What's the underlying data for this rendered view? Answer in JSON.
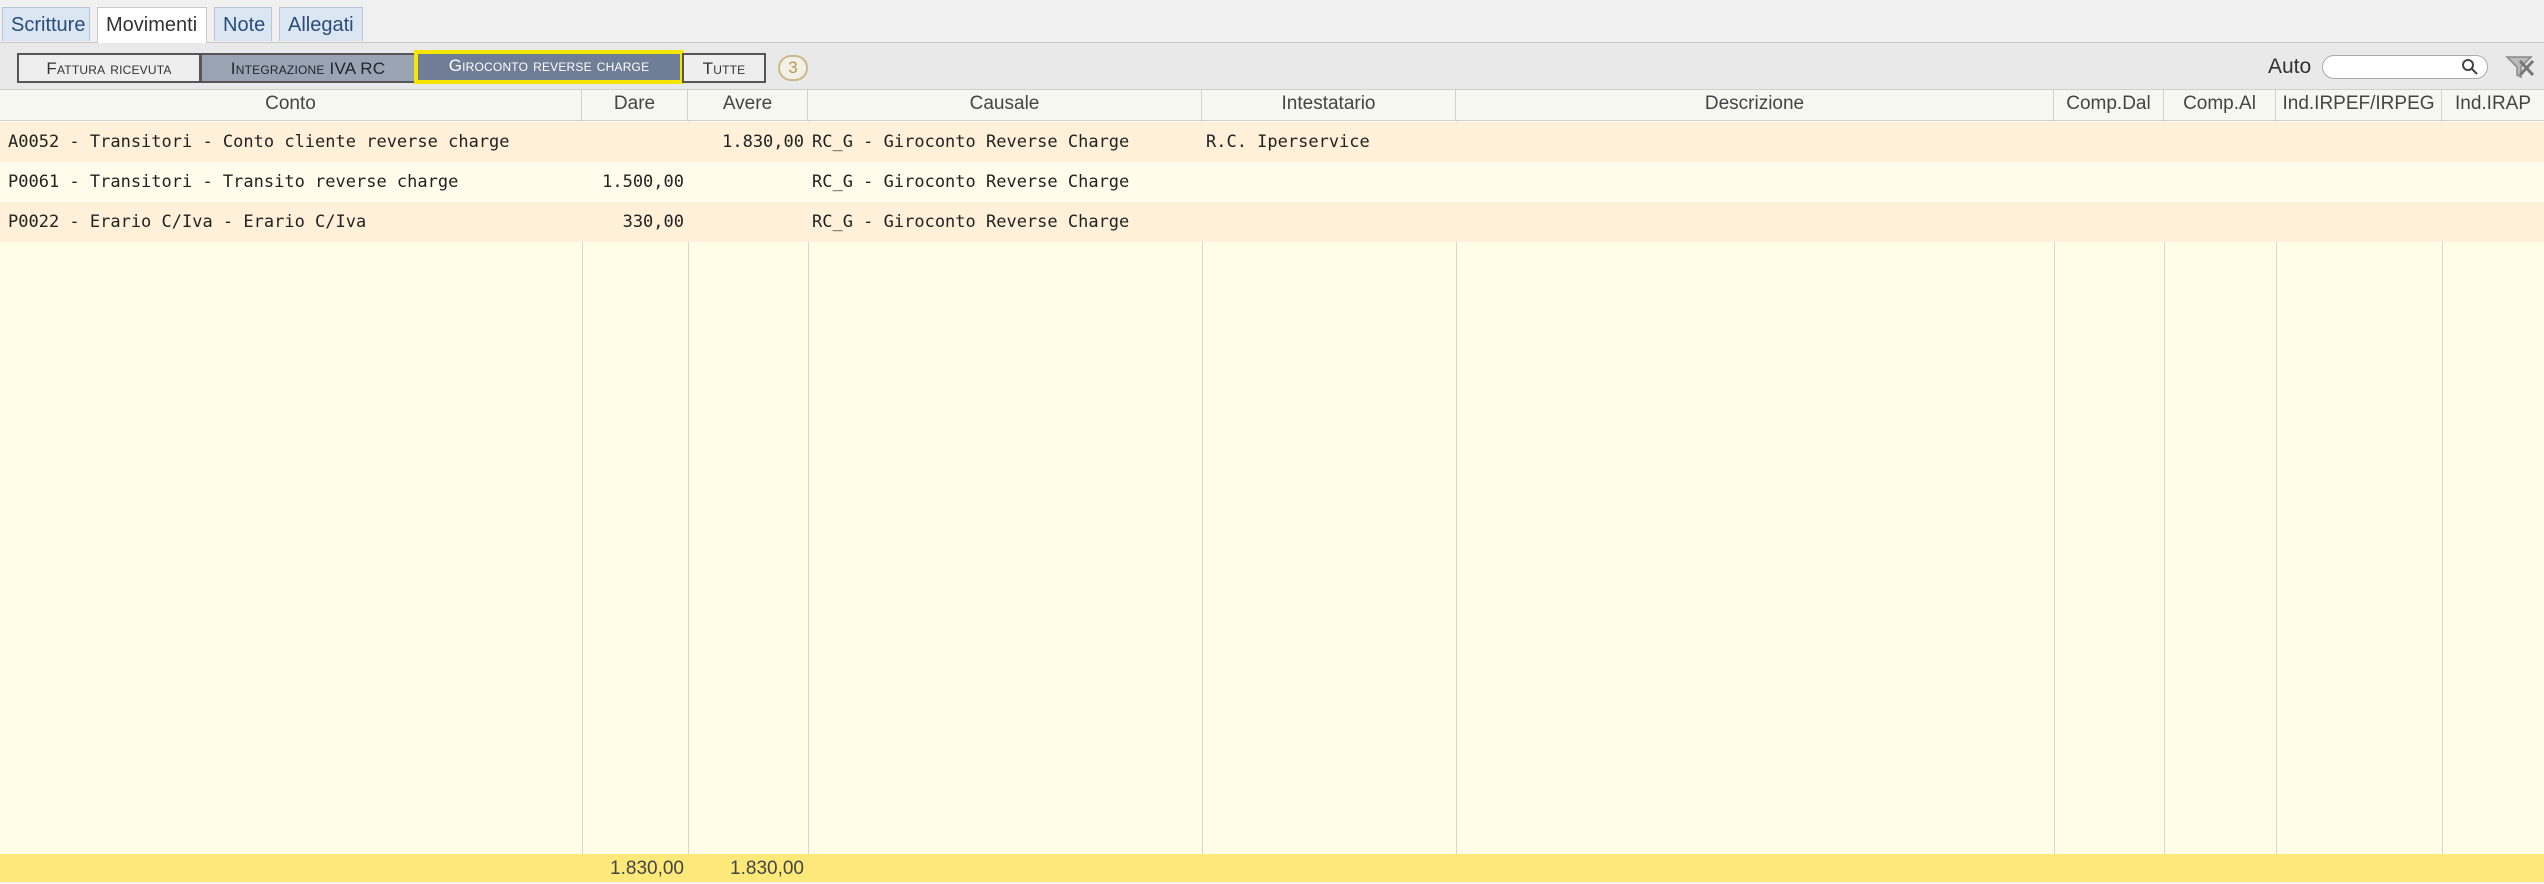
{
  "tabs": [
    {
      "label": "Scritture"
    },
    {
      "label": "Movimenti"
    },
    {
      "label": "Note"
    },
    {
      "label": "Allegati"
    }
  ],
  "filters": {
    "buttons": [
      {
        "label": "Fattura ricevuta"
      },
      {
        "label": "Integrazione IVA RC"
      },
      {
        "label": "Giroconto reverse charge"
      },
      {
        "label": "Tutte"
      }
    ],
    "count": "3",
    "auto_label": "Auto",
    "search_value": ""
  },
  "columns": [
    "Conto",
    "Dare",
    "Avere",
    "Causale",
    "Intestatario",
    "Descrizione",
    "Comp.Dal",
    "Comp.Al",
    "Ind.IRPEF/IRPEG",
    "Ind.IRAP"
  ],
  "rows": [
    {
      "conto": "A0052 - Transitori - Conto cliente reverse charge",
      "dare": "",
      "avere": "1.830,00",
      "causale": "RC_G - Giroconto Reverse Charge",
      "intestatario": "R.C. Iperservice"
    },
    {
      "conto": "P0061 - Transitori - Transito reverse charge",
      "dare": "1.500,00",
      "avere": "",
      "causale": "RC_G - Giroconto Reverse Charge",
      "intestatario": ""
    },
    {
      "conto": "P0022 - Erario C/Iva - Erario C/Iva",
      "dare": "330,00",
      "avere": "",
      "causale": "RC_G - Giroconto Reverse Charge",
      "intestatario": ""
    }
  ],
  "totals": {
    "dare": "1.830,00",
    "avere": "1.830,00"
  },
  "colors": {
    "selected_border": "#f4e600",
    "totals_bg": "#fde97a",
    "row_odd": "#fff1d9",
    "row_even": "#fffceb"
  },
  "icons": {
    "search": "search-icon",
    "clear": "clear-filter-icon"
  }
}
